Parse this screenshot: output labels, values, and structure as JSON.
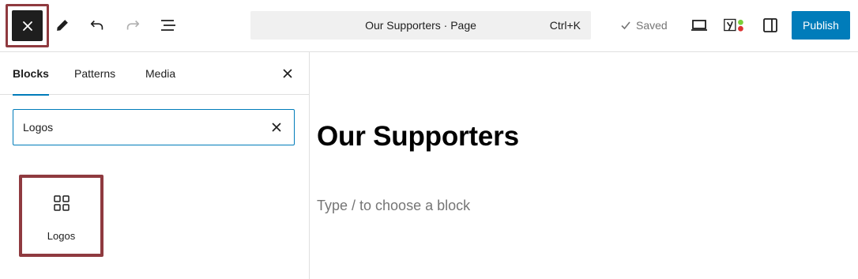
{
  "toolbar": {
    "close_icon": "close-icon",
    "tools_icon": "pencil-icon",
    "undo_icon": "undo-icon",
    "redo_icon": "redo-icon",
    "list_view_icon": "list-view-icon",
    "command": {
      "title": "Our Supporters · Page",
      "shortcut": "Ctrl+K"
    },
    "saved_label": "Saved",
    "view_icon": "laptop-icon",
    "yoast_icon": "yoast-icon",
    "settings_icon": "sidebar-toggle-icon",
    "publish_label": "Publish",
    "colors": {
      "accent": "#007cba",
      "dark": "#1e1e1e",
      "highlight_border": "#8f3a3f",
      "yoast_green": "#7ad03a",
      "yoast_red": "#dc3232"
    }
  },
  "sidebar": {
    "tabs": [
      {
        "label": "Blocks",
        "active": true
      },
      {
        "label": "Patterns",
        "active": false
      },
      {
        "label": "Media",
        "active": false
      }
    ],
    "search": {
      "value": "Logos",
      "placeholder": "Search"
    },
    "results": [
      {
        "label": "Logos",
        "icon": "grid-icon"
      }
    ]
  },
  "canvas": {
    "title": "Our Supporters",
    "placeholder": "Type / to choose a block"
  }
}
